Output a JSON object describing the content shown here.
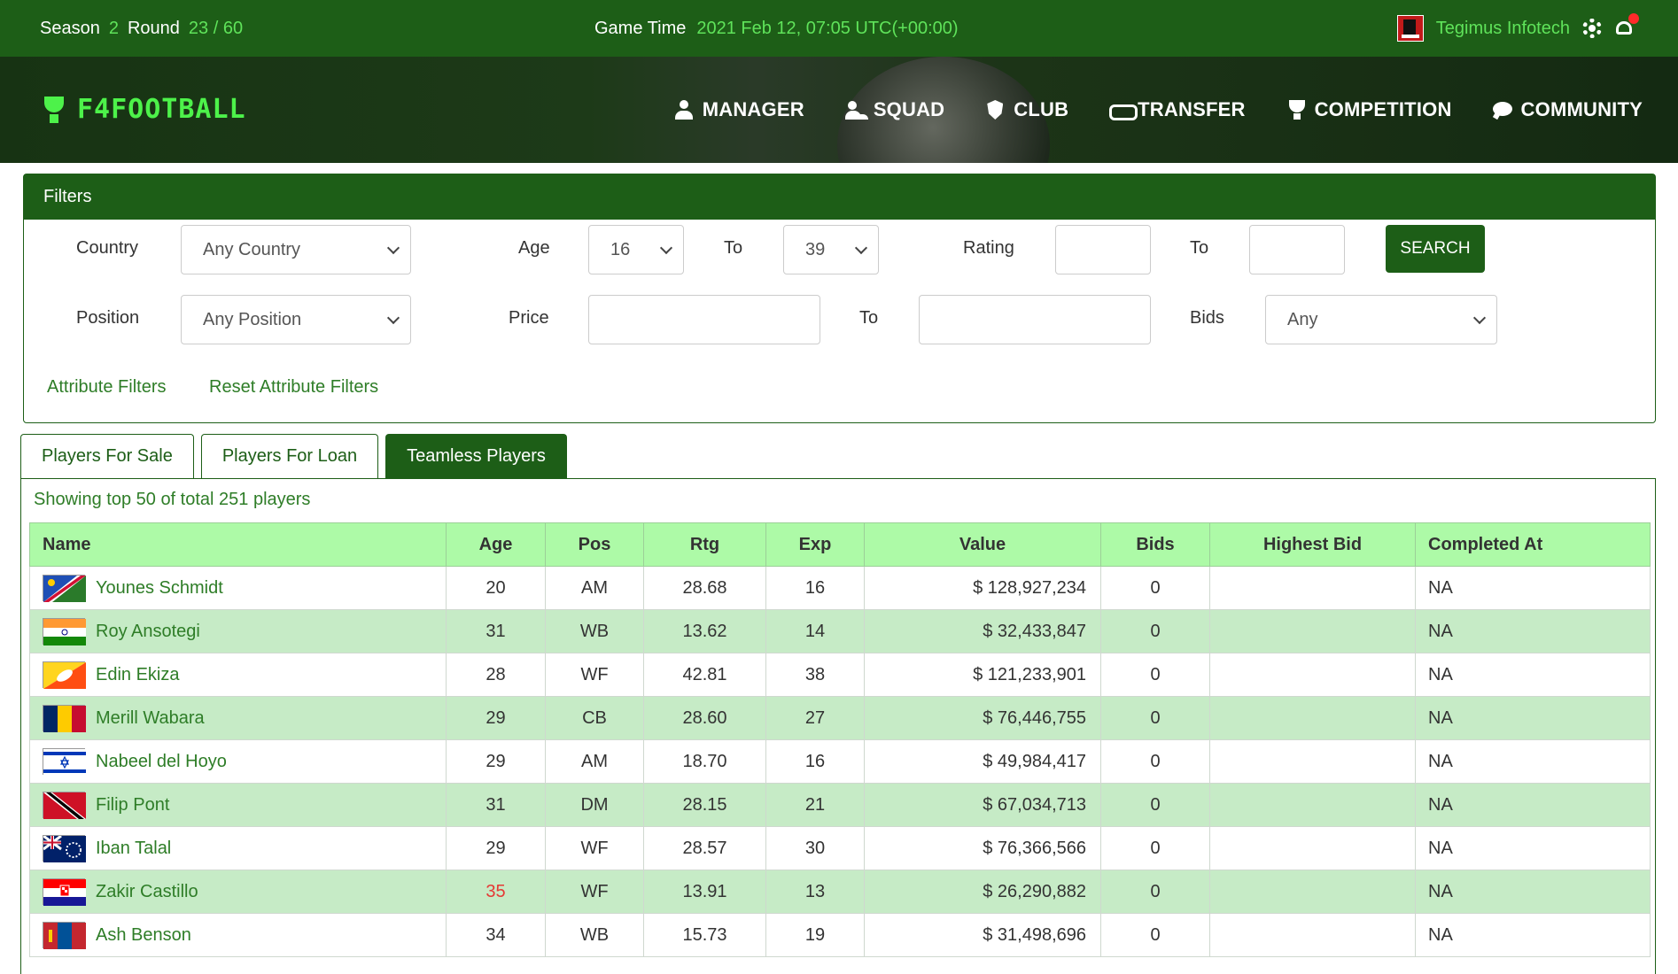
{
  "topbar": {
    "season_label": "Season",
    "season_value": "2",
    "round_label": "Round",
    "round_value": "23 / 60",
    "gametime_label": "Game Time",
    "gametime_value": "2021 Feb 12, 07:05 UTC(+00:00)",
    "user_name": "Tegimus Infotech"
  },
  "brand": {
    "logo_text": "F4FOOTBALL"
  },
  "nav": [
    {
      "label": "MANAGER",
      "icon": "manager-icon"
    },
    {
      "label": "SQUAD",
      "icon": "squad-icon"
    },
    {
      "label": "CLUB",
      "icon": "club-icon"
    },
    {
      "label": "TRANSFER",
      "icon": "transfer-icon"
    },
    {
      "label": "COMPETITION",
      "icon": "competition-icon"
    },
    {
      "label": "COMMUNITY",
      "icon": "community-icon"
    }
  ],
  "filters": {
    "title": "Filters",
    "country_label": "Country",
    "country_value": "Any Country",
    "age_label": "Age",
    "age_from": "16",
    "age_to_label": "To",
    "age_to": "39",
    "rating_label": "Rating",
    "rating_to_label": "To",
    "search_label": "SEARCH",
    "position_label": "Position",
    "position_value": "Any Position",
    "price_label": "Price",
    "price_to_label": "To",
    "bids_label": "Bids",
    "bids_value": "Any",
    "attr_filters": "Attribute Filters",
    "reset_attr_filters": "Reset Attribute Filters"
  },
  "tabs": [
    {
      "label": "Players For Sale",
      "active": false
    },
    {
      "label": "Players For Loan",
      "active": false
    },
    {
      "label": "Teamless Players",
      "active": true
    }
  ],
  "showing_text": "Showing top 50 of total 251 players",
  "table": {
    "headers": {
      "name": "Name",
      "age": "Age",
      "pos": "Pos",
      "rtg": "Rtg",
      "exp": "Exp",
      "value": "Value",
      "bids": "Bids",
      "highest_bid": "Highest Bid",
      "completed_at": "Completed At"
    },
    "rows": [
      {
        "name": "Younes Schmidt",
        "age": "20",
        "pos": "AM",
        "rtg": "28.68",
        "exp": "16",
        "value": "$ 128,927,234",
        "bids": "0",
        "highest_bid": "",
        "completed_at": "NA",
        "flag": "namibia-flag"
      },
      {
        "name": "Roy Ansotegi",
        "age": "31",
        "pos": "WB",
        "rtg": "13.62",
        "exp": "14",
        "value": "$ 32,433,847",
        "bids": "0",
        "highest_bid": "",
        "completed_at": "NA",
        "flag": "india-flag"
      },
      {
        "name": "Edin Ekiza",
        "age": "28",
        "pos": "WF",
        "rtg": "42.81",
        "exp": "38",
        "value": "$ 121,233,901",
        "bids": "0",
        "highest_bid": "",
        "completed_at": "NA",
        "flag": "bhutan-flag"
      },
      {
        "name": "Merill Wabara",
        "age": "29",
        "pos": "CB",
        "rtg": "28.60",
        "exp": "27",
        "value": "$ 76,446,755",
        "bids": "0",
        "highest_bid": "",
        "completed_at": "NA",
        "flag": "chad-flag"
      },
      {
        "name": "Nabeel del Hoyo",
        "age": "29",
        "pos": "AM",
        "rtg": "18.70",
        "exp": "16",
        "value": "$ 49,984,417",
        "bids": "0",
        "highest_bid": "",
        "completed_at": "NA",
        "flag": "israel-flag"
      },
      {
        "name": "Filip Pont",
        "age": "31",
        "pos": "DM",
        "rtg": "28.15",
        "exp": "21",
        "value": "$ 67,034,713",
        "bids": "0",
        "highest_bid": "",
        "completed_at": "NA",
        "flag": "trinidad-flag"
      },
      {
        "name": "Iban Talal",
        "age": "29",
        "pos": "WF",
        "rtg": "28.57",
        "exp": "30",
        "value": "$ 76,366,566",
        "bids": "0",
        "highest_bid": "",
        "completed_at": "NA",
        "flag": "cook-islands-flag"
      },
      {
        "name": "Zakir Castillo",
        "age": "35",
        "pos": "WF",
        "rtg": "13.91",
        "exp": "13",
        "value": "$ 26,290,882",
        "bids": "0",
        "highest_bid": "",
        "completed_at": "NA",
        "flag": "croatia-flag",
        "age_highlight": true
      },
      {
        "name": "Ash Benson",
        "age": "34",
        "pos": "WB",
        "rtg": "15.73",
        "exp": "19",
        "value": "$ 31,498,696",
        "bids": "0",
        "highest_bid": "",
        "completed_at": "NA",
        "flag": "mongolia-flag"
      }
    ]
  },
  "colors": {
    "primary": "#1d5e17",
    "accent_green": "#5fe35a",
    "header_row": "#adfaa7",
    "alt_row": "#c6ebc6",
    "link": "#2e7d27",
    "warning": "#e53935"
  }
}
